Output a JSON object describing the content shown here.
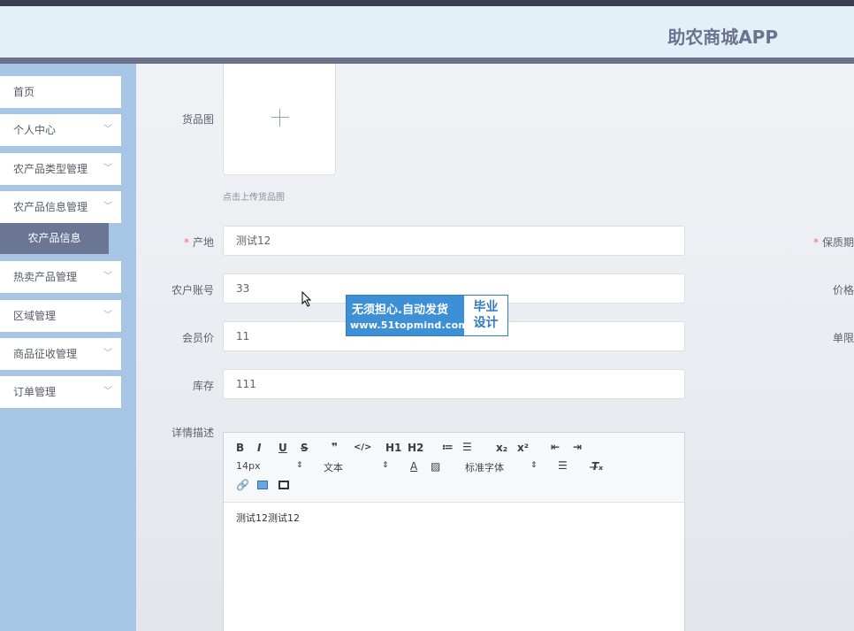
{
  "app": {
    "title": "助农商城APP"
  },
  "sidebar": {
    "items": [
      {
        "label": "首页",
        "has_chevron": false
      },
      {
        "label": "个人中心",
        "has_chevron": true
      },
      {
        "label": "农产品类型管理",
        "has_chevron": true
      },
      {
        "label": "农产品信息管理",
        "has_chevron": true
      },
      {
        "label": "热卖产品管理",
        "has_chevron": true
      },
      {
        "label": "区域管理",
        "has_chevron": true
      },
      {
        "label": "商品征收管理",
        "has_chevron": true
      },
      {
        "label": "订单管理",
        "has_chevron": true
      }
    ],
    "active_sub_item": "农产品信息",
    "chevron_glyph": "﹀"
  },
  "form": {
    "image_label": "货品图",
    "upload_hint": "点击上传货品图",
    "required_mark": "*",
    "origin_label": "产地",
    "origin_value": "测试12",
    "farmer_account_label": "农户账号",
    "farmer_account_value": "33",
    "member_price_label": "会员价",
    "member_price_value": "11",
    "stock_label": "库存",
    "stock_value": "111",
    "detail_label": "详情描述",
    "right_labels": {
      "shelf_life": "保质期",
      "price": "价格",
      "single_limit": "单限"
    }
  },
  "editor": {
    "font_size": "14px",
    "paragraph": "文本",
    "font_family": "标准字体",
    "content": "测试12测试12",
    "buttons": [
      "B",
      "I",
      "U",
      "S",
      "❞",
      "</>",
      "H1",
      "H2",
      "≔",
      "☰",
      "x₂",
      "x²",
      "⇤",
      "⇥"
    ]
  },
  "watermark": {
    "line1": "无须担心.自动发货",
    "line2": "www.51topmind.com",
    "right_line1": "毕业",
    "right_line2": "设计"
  }
}
